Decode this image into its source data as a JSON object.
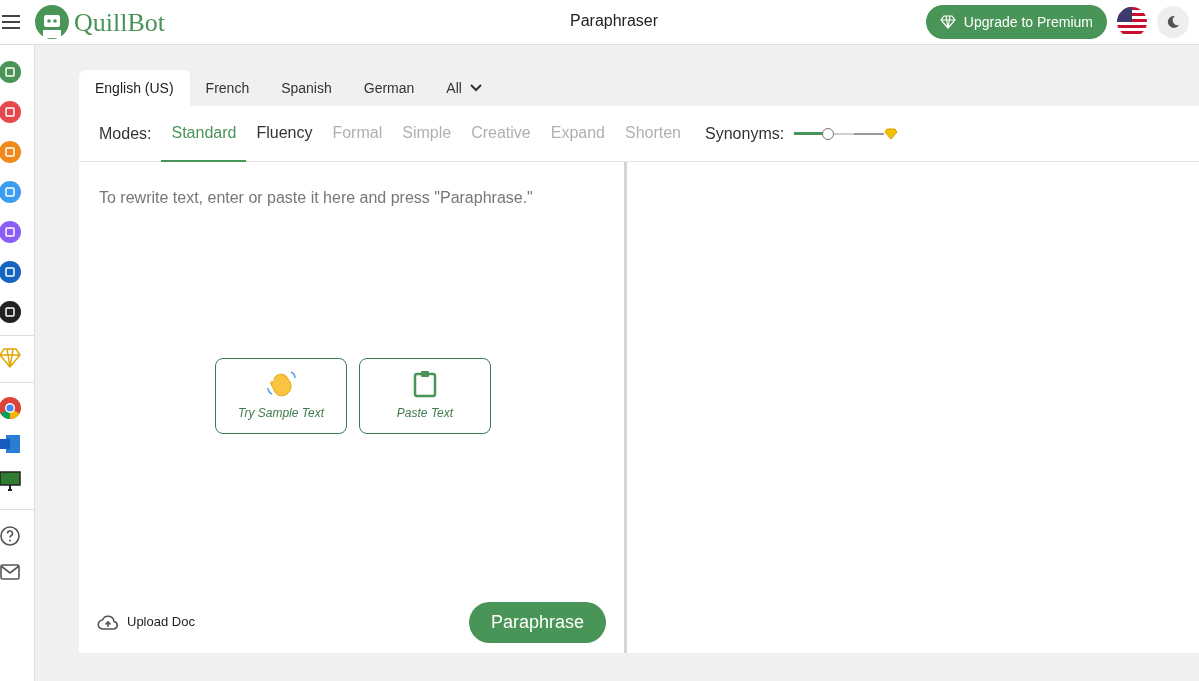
{
  "header": {
    "logo_text": "QuillBot",
    "page_title": "Paraphraser",
    "upgrade_button": "Upgrade to Premium"
  },
  "language_tabs": [
    {
      "label": "English (US)",
      "selected": true
    },
    {
      "label": "French",
      "selected": false
    },
    {
      "label": "Spanish",
      "selected": false
    },
    {
      "label": "German",
      "selected": false
    },
    {
      "label": "All",
      "selected": false,
      "kind": "dropdown"
    }
  ],
  "modes": {
    "label": "Modes:",
    "items": [
      {
        "label": "Standard",
        "selected": true,
        "disabled": false
      },
      {
        "label": "Fluency",
        "selected": false,
        "disabled": false
      },
      {
        "label": "Formal",
        "selected": false,
        "disabled": true
      },
      {
        "label": "Simple",
        "selected": false,
        "disabled": true
      },
      {
        "label": "Creative",
        "selected": false,
        "disabled": true
      },
      {
        "label": "Expand",
        "selected": false,
        "disabled": true
      },
      {
        "label": "Shorten",
        "selected": false,
        "disabled": true
      }
    ]
  },
  "synonyms": {
    "label": "Synonyms:",
    "level": 0.33
  },
  "input": {
    "placeholder": "To rewrite text, enter or paste it here and press \"Paraphrase.\""
  },
  "actions": [
    {
      "kind": "sample",
      "label": "Try Sample Text"
    },
    {
      "kind": "paste",
      "label": "Paste Text"
    }
  ],
  "upload_label": "Upload Doc",
  "paraphrase_button": "Paraphrase"
}
